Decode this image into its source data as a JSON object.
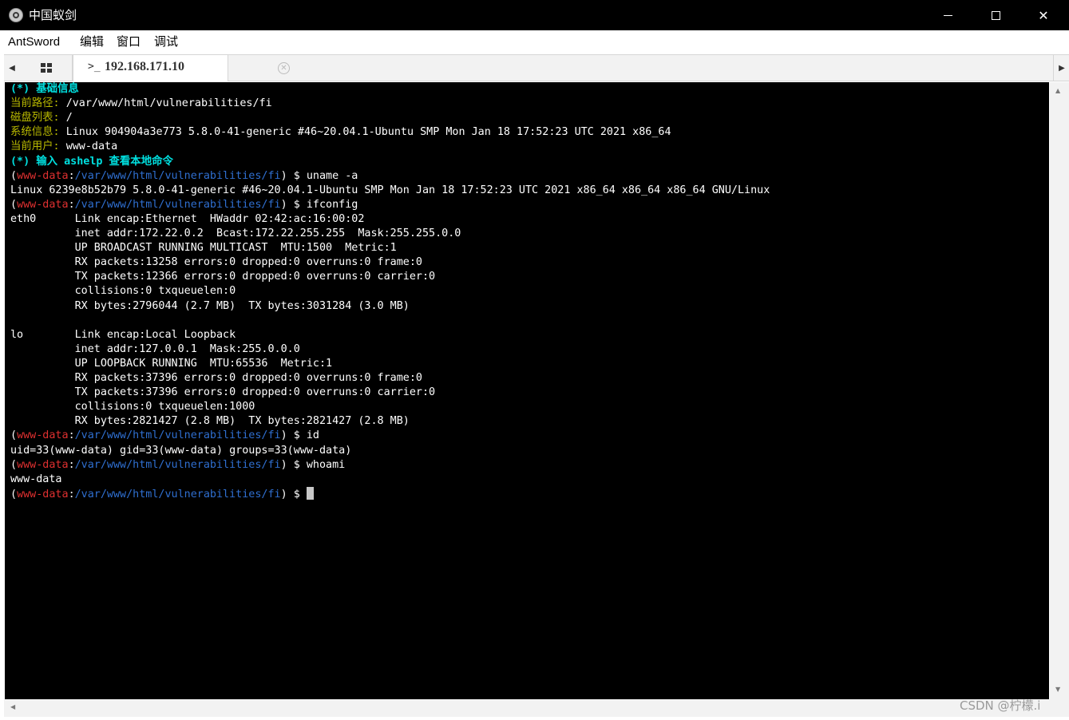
{
  "window": {
    "title": "中国蚁剑",
    "min_glyph": "",
    "close_glyph": "✕"
  },
  "menu": {
    "items": [
      "AntSword",
      "编辑",
      "窗口",
      "调试"
    ]
  },
  "tabs": {
    "left_arrow": "◀",
    "right_arrow": "▶",
    "grid_icon": "grid-icon",
    "terminal_tab": {
      "icon": ">_",
      "label": "192.168.171.10",
      "close_glyph": "✕"
    }
  },
  "terminal": {
    "prompt": {
      "open": "(",
      "user": "www-data",
      "sep": ":",
      "path": "/var/www/html/vulnerabilities/fi",
      "close": ")",
      "dollar": " $ "
    },
    "lines": [
      {
        "kind": "info",
        "segments": [
          {
            "t": "(*) 基础信息",
            "c": "cyan"
          }
        ]
      },
      {
        "kind": "info",
        "segments": [
          {
            "t": "当前路径: ",
            "c": "olive"
          },
          {
            "t": "/var/www/html/vulnerabilities/fi",
            "c": "white"
          }
        ]
      },
      {
        "kind": "info",
        "segments": [
          {
            "t": "磁盘列表: ",
            "c": "olive"
          },
          {
            "t": "/",
            "c": "white"
          }
        ]
      },
      {
        "kind": "info",
        "segments": [
          {
            "t": "系统信息: ",
            "c": "olive"
          },
          {
            "t": "Linux 904904a3e773 5.8.0-41-generic #46~20.04.1-Ubuntu SMP Mon Jan 18 17:52:23 UTC 2021 x86_64",
            "c": "white"
          }
        ]
      },
      {
        "kind": "info",
        "segments": [
          {
            "t": "当前用户: ",
            "c": "olive"
          },
          {
            "t": "www-data",
            "c": "white"
          }
        ]
      },
      {
        "kind": "info",
        "segments": [
          {
            "t": "(*) 输入 ashelp 查看本地命令",
            "c": "cyan"
          }
        ]
      },
      {
        "kind": "prompt",
        "cmd": "uname -a"
      },
      {
        "kind": "output",
        "text": "Linux 6239e8b52b79 5.8.0-41-generic #46~20.04.1-Ubuntu SMP Mon Jan 18 17:52:23 UTC 2021 x86_64 x86_64 x86_64 GNU/Linux"
      },
      {
        "kind": "prompt",
        "cmd": "ifconfig"
      },
      {
        "kind": "output",
        "text": "eth0      Link encap:Ethernet  HWaddr 02:42:ac:16:00:02"
      },
      {
        "kind": "output",
        "text": "          inet addr:172.22.0.2  Bcast:172.22.255.255  Mask:255.255.0.0"
      },
      {
        "kind": "output",
        "text": "          UP BROADCAST RUNNING MULTICAST  MTU:1500  Metric:1"
      },
      {
        "kind": "output",
        "text": "          RX packets:13258 errors:0 dropped:0 overruns:0 frame:0"
      },
      {
        "kind": "output",
        "text": "          TX packets:12366 errors:0 dropped:0 overruns:0 carrier:0"
      },
      {
        "kind": "output",
        "text": "          collisions:0 txqueuelen:0"
      },
      {
        "kind": "output",
        "text": "          RX bytes:2796044 (2.7 MB)  TX bytes:3031284 (3.0 MB)"
      },
      {
        "kind": "output",
        "text": ""
      },
      {
        "kind": "output",
        "text": "lo        Link encap:Local Loopback"
      },
      {
        "kind": "output",
        "text": "          inet addr:127.0.0.1  Mask:255.0.0.0"
      },
      {
        "kind": "output",
        "text": "          UP LOOPBACK RUNNING  MTU:65536  Metric:1"
      },
      {
        "kind": "output",
        "text": "          RX packets:37396 errors:0 dropped:0 overruns:0 frame:0"
      },
      {
        "kind": "output",
        "text": "          TX packets:37396 errors:0 dropped:0 overruns:0 carrier:0"
      },
      {
        "kind": "output",
        "text": "          collisions:0 txqueuelen:1000"
      },
      {
        "kind": "output",
        "text": "          RX bytes:2821427 (2.8 MB)  TX bytes:2821427 (2.8 MB)"
      },
      {
        "kind": "prompt",
        "cmd": "id"
      },
      {
        "kind": "output",
        "text": "uid=33(www-data) gid=33(www-data) groups=33(www-data)"
      },
      {
        "kind": "prompt",
        "cmd": "whoami"
      },
      {
        "kind": "output",
        "text": "www-data"
      },
      {
        "kind": "prompt",
        "cmd": "",
        "cursor": true
      }
    ]
  },
  "scrollbars": {
    "up_arrow": "▲",
    "down_arrow": "▼",
    "left_arrow": "◀"
  },
  "watermark": "CSDN @柠檬.i",
  "colors": {
    "titlebar": "#000000",
    "terminal_bg": "#000000",
    "cyan": "#00e0e0",
    "olive": "#b8b800",
    "red": "#e03030",
    "blue": "#2f6fd0"
  }
}
